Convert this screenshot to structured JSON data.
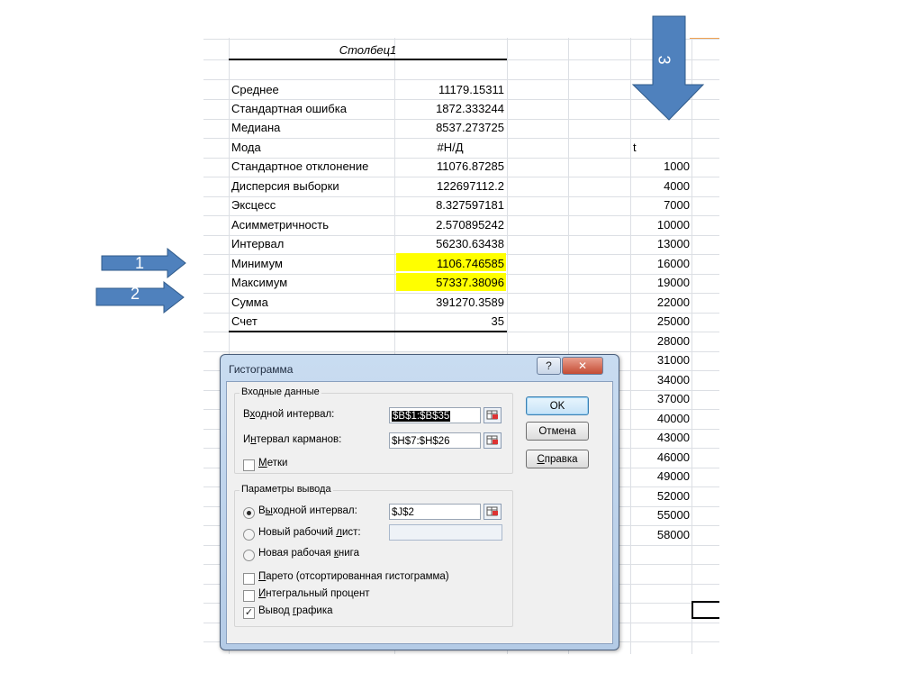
{
  "sheet": {
    "header": "Столбец1",
    "stats": [
      {
        "label": "Среднее",
        "value": "11179.15311"
      },
      {
        "label": "Стандартная ошибка",
        "value": "1872.333244"
      },
      {
        "label": "Медиана",
        "value": "8537.273725"
      },
      {
        "label": "Мода",
        "value": "#Н/Д"
      },
      {
        "label": "Стандартное отклонение",
        "value": "11076.87285"
      },
      {
        "label": "Дисперсия выборки",
        "value": "122697112.2"
      },
      {
        "label": "Эксцесс",
        "value": "8.327597181"
      },
      {
        "label": "Асимметричность",
        "value": "2.570895242"
      },
      {
        "label": "Интервал",
        "value": "56230.63438"
      },
      {
        "label": "Минимум",
        "value": "1106.746585"
      },
      {
        "label": "Максимум",
        "value": "57337.38096"
      },
      {
        "label": "Сумма",
        "value": "391270.3589"
      },
      {
        "label": "Счет",
        "value": "35"
      }
    ],
    "bins_header": "t",
    "bins": [
      "1000",
      "4000",
      "7000",
      "10000",
      "13000",
      "16000",
      "19000",
      "22000",
      "25000",
      "28000",
      "31000",
      "34000",
      "37000",
      "40000",
      "43000",
      "46000",
      "49000",
      "52000",
      "55000",
      "58000"
    ],
    "highlight_color": "#ffff00"
  },
  "arrows": {
    "a1": "1",
    "a2": "2",
    "a3": "3",
    "color": "#4f81bd"
  },
  "dialog": {
    "title": "Гистограмма",
    "help_label": "?",
    "close_label": "✕",
    "input_group": "Входные данные",
    "input_range_label_pre": "В",
    "input_range_label_u": "х",
    "input_range_label_post": "одной интервал:",
    "input_range_value": "$B$1:$B$35",
    "bin_range_label_pre": "И",
    "bin_range_label_u": "н",
    "bin_range_label_post": "тервал карманов:",
    "bin_range_value": "$H$7:$H$26",
    "labels_pre": "",
    "labels_u": "М",
    "labels_post": "етки",
    "output_group": "Параметры вывода",
    "out_range_label_pre": "В",
    "out_range_label_u": "ы",
    "out_range_label_post": "ходной интервал:",
    "out_range_value": "$J$2",
    "new_sheet_label_pre": "Новый рабочий ",
    "new_sheet_label_u": "л",
    "new_sheet_label_post": "ист:",
    "new_sheet_value": "",
    "new_book_label_pre": "Новая рабочая ",
    "new_book_label_u": "к",
    "new_book_label_post": "нига",
    "pareto_label_pre": "",
    "pareto_label_u": "П",
    "pareto_label_post": "арето (отсортированная гистограмма)",
    "cumulative_label_pre": "",
    "cumulative_label_u": "И",
    "cumulative_label_post": "нтегральный процент",
    "chart_label_pre": "Вывод ",
    "chart_label_u": "г",
    "chart_label_post": "рафика",
    "ok": "OK",
    "cancel": "Отмена",
    "help_pre": "",
    "help_u": "С",
    "help_post": "правка",
    "checked_mark": "✓",
    "ref_icon": "range-picker-icon"
  }
}
